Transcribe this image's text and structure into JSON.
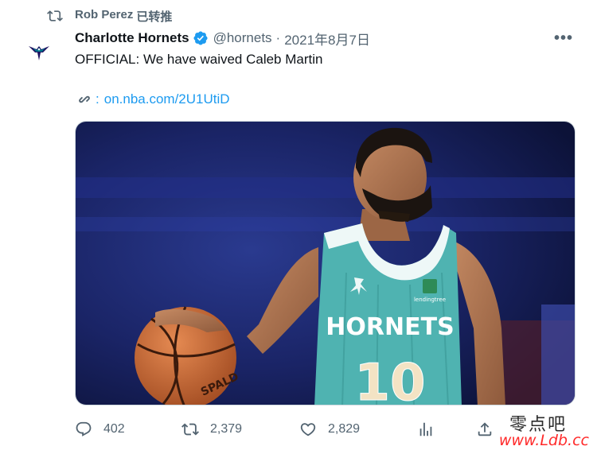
{
  "retweet": {
    "icon": "retweet-icon",
    "name": "Rob Perez",
    "action": "已转推"
  },
  "tweet": {
    "avatar_icon": "hornets-logo",
    "display_name": "Charlotte Hornets",
    "verified_icon": "verified-badge-icon",
    "handle": "@hornets",
    "separator": "·",
    "date": "2021年8月7日",
    "more_icon": "more-options-icon",
    "more_label": "•••",
    "text": "OFFICIAL: We have waived Caleb Martin",
    "link_icon": "link-icon",
    "link_colon": ":",
    "link_text": "on.nba.com/2U1UtiD",
    "media": {
      "jersey_team": "HORNETS",
      "jersey_number": "10",
      "ball_brand": "SPALD",
      "sponsor": "lendingtree"
    }
  },
  "actions": {
    "reply": {
      "icon": "reply-icon",
      "count": "402"
    },
    "retweet": {
      "icon": "retweet-icon",
      "count": "2,379"
    },
    "like": {
      "icon": "heart-icon",
      "count": "2,829"
    },
    "views": {
      "icon": "analytics-icon"
    },
    "share": {
      "icon": "share-icon"
    }
  },
  "watermark": {
    "chinese": "零点吧",
    "url": "www.Ldb.cc"
  },
  "colors": {
    "link": "#1d9bf0",
    "secondary_text": "#536471",
    "primary_text": "#0f1419",
    "verified": "#1d9bf0",
    "jersey_teal": "#4fb3b1",
    "watermark_url": "#ff2a2a"
  }
}
